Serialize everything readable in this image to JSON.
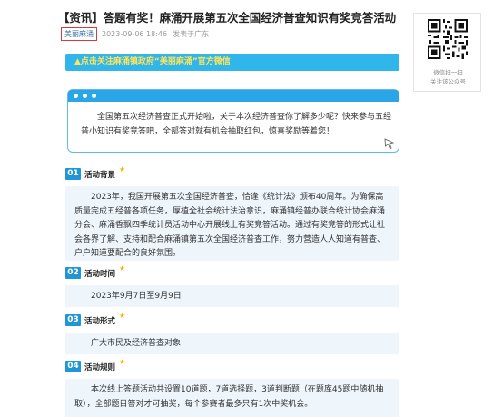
{
  "article": {
    "title": "【资讯】答题有奖！麻涌开展第五次全国经济普查知识有奖竞答活动",
    "source": "美丽麻涌",
    "date": "2023-09-06 18:46",
    "location": "发表于广东",
    "follow_banner": "▲点击关注麻涌镇政府“美丽麻涌”官方微信",
    "intro": "全国第五次经济普查正式开始啦，关于本次经济普查你了解多少呢？快来参与五经普小知识有奖竞答吧，全部答对就有机会抽取红包，惊喜奖励等着您！",
    "sections": [
      {
        "number": "01",
        "title": "活动背景",
        "body": "2023年，我国开展第五次全国经济普查，恰逢《统计法》颁布40周年。为确保高质量完成五经普各项任务，厚植全社会统计法治意识，麻涌镇经普办联合统计协会麻涌分会、麻涌香飘四季统计员活动中心开展线上有奖竞答活动。通过有奖竞答的形式让社会各界了解、支持和配合麻涌镇第五次全国经济普查工作，努力营造人人知道有普查、户户知道要配合的良好氛围。"
      },
      {
        "number": "02",
        "title": "活动时间",
        "body": "2023年9月7日至9月9日"
      },
      {
        "number": "03",
        "title": "活动形式",
        "body": "广大市民及经济普查对象"
      },
      {
        "number": "04",
        "title": "活动规则",
        "body": "本次线上答题活动共设置10道题，7道选择题，3道判断题（在题库45题中随机抽取），全部题目答对才可抽奖，每个参赛者最多只有1次中奖机会。"
      }
    ]
  },
  "qr": {
    "caption_line1": "微信扫一扫",
    "caption_line2": "关注该公众号"
  },
  "colors": {
    "accent_blue": "#2196d6",
    "banner_blue": "#30b6ea",
    "banner_text": "#ffe45c",
    "source_border": "#d93b3b",
    "section_bg": "#eef6fc"
  },
  "icons": {
    "star": "star-icon",
    "cursor": "pointer-cursor-icon",
    "dots": "window-dots-icon",
    "qr": "qr-code-icon"
  }
}
